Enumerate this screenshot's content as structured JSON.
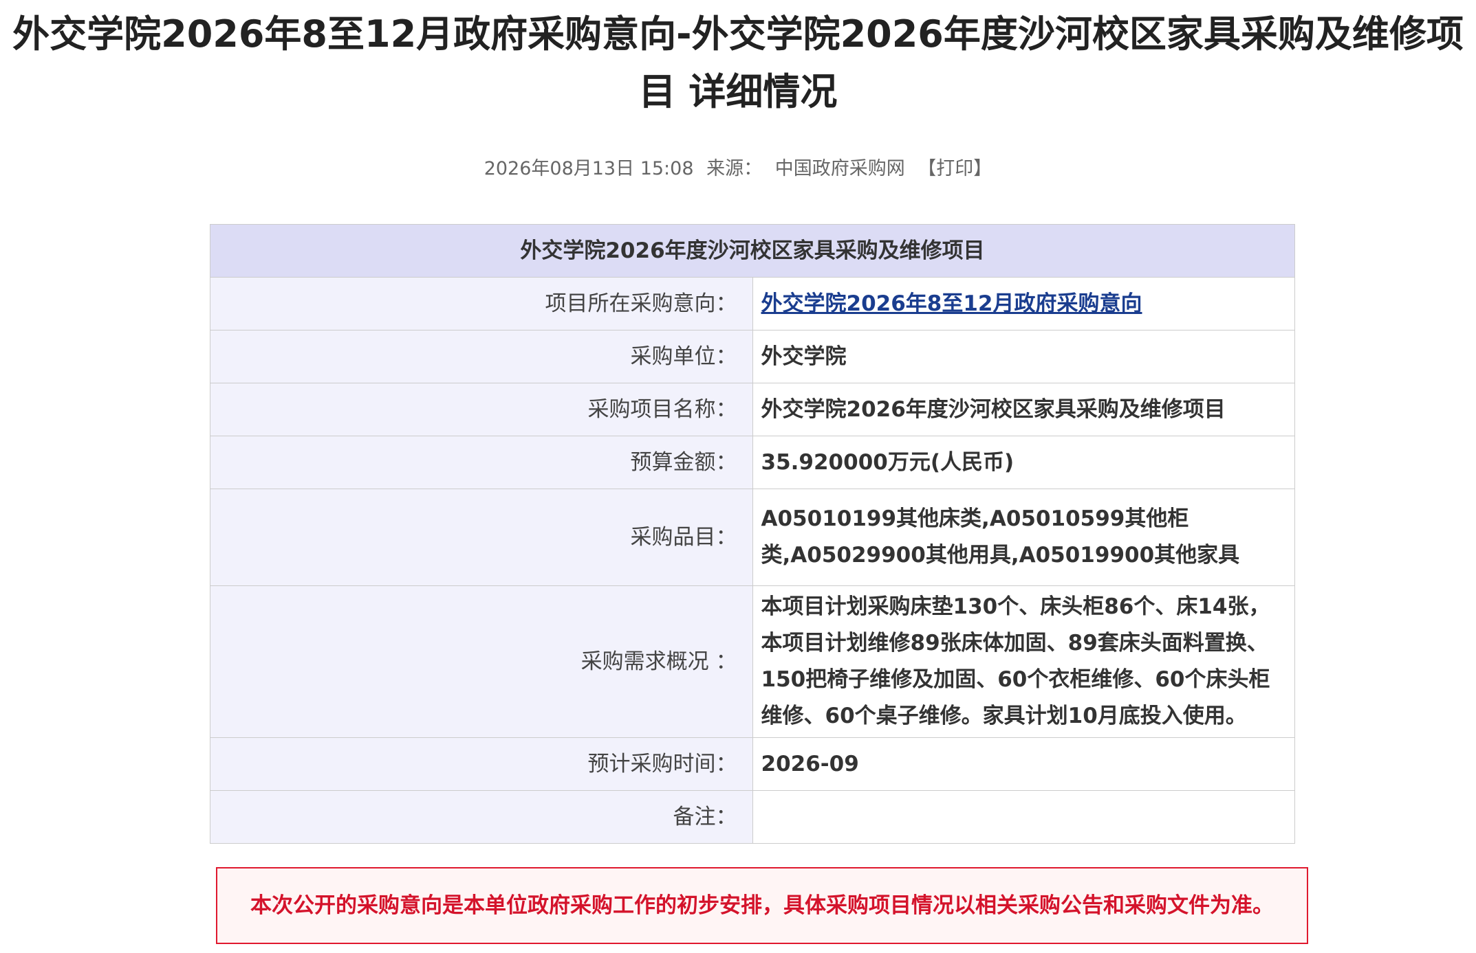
{
  "page": {
    "title": "外交学院2026年8至12月政府采购意向-外交学院2026年度沙河校区家具采购及维修项目 详细情况"
  },
  "meta": {
    "datetime": "2026年08月13日 15:08",
    "source_label": "来源：",
    "source_name": "中国政府采购网",
    "print_label": "【打印】"
  },
  "table": {
    "heading": "外交学院2026年度沙河校区家具采购及维修项目",
    "rows": [
      {
        "label": "项目所在采购意向：",
        "value": "外交学院2026年8至12月政府采购意向"
      },
      {
        "label": "采购单位：",
        "value": "外交学院"
      },
      {
        "label": "采购项目名称：",
        "value": "外交学院2026年度沙河校区家具采购及维修项目"
      },
      {
        "label": "预算金额：",
        "value": "35.920000万元(人民币)"
      },
      {
        "label": "采购品目：",
        "value": "A05010199其他床类,A05010599其他柜类,A05029900其他用具,A05019900其他家具"
      },
      {
        "label": "采购需求概况 ：",
        "value": "本项目计划采购床垫130个、床头柜86个、床14张，本项目计划维修89张床体加固、89套床头面料置换、150把椅子维修及加固、60个衣柜维修、60个床头柜维修、60个桌子维修。家具计划10月底投入使用。"
      },
      {
        "label": "预计采购时间：",
        "value": "2026-09"
      },
      {
        "label": "备注：",
        "value": ""
      }
    ]
  },
  "notice": {
    "text": "本次公开的采购意向是本单位政府采购工作的初步安排，具体采购项目情况以相关采购公告和采购文件为准。"
  },
  "colors": {
    "table_head_bg": "#dcdcf5",
    "label_bg": "#f2f2fc",
    "link": "#1a3d8f",
    "notice_red": "#d4132b"
  }
}
